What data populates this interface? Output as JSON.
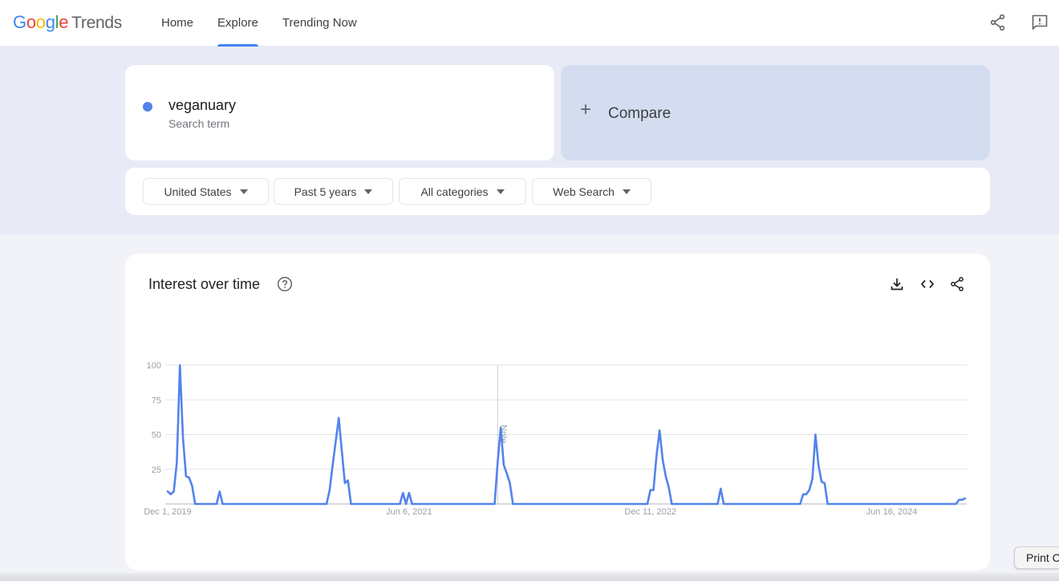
{
  "app": {
    "logo": {
      "google": [
        "G",
        "o",
        "o",
        "g",
        "l",
        "e"
      ],
      "product": "Trends"
    },
    "nav": [
      {
        "label": "Home",
        "active": false
      },
      {
        "label": "Explore",
        "active": true
      },
      {
        "label": "Trending Now",
        "active": false
      }
    ],
    "top_icons": [
      "share-icon",
      "feedback-icon"
    ]
  },
  "search": {
    "term": "veganuary",
    "term_type": "Search term",
    "term_color": "#5383ec",
    "compare_label": "Compare",
    "compare_icon": "+"
  },
  "filters": [
    {
      "label": "United States"
    },
    {
      "label": "Past 5 years"
    },
    {
      "label": "All categories"
    },
    {
      "label": "Web Search"
    }
  ],
  "card": {
    "title": "Interest over time",
    "icons": [
      "help-icon",
      "download-icon",
      "embed-icon",
      "share-icon"
    ]
  },
  "tooltip": {
    "label": "Print C"
  },
  "chart_data": {
    "type": "line",
    "title": "Interest over time",
    "xlabel": "",
    "ylabel": "",
    "ylim": [
      0,
      100
    ],
    "yticks": [
      25,
      50,
      75,
      100
    ],
    "grid": true,
    "legend": "none",
    "x_unit": "week",
    "x_start": "Dec 1, 2019",
    "num_points": 262,
    "xtick_labels": [
      {
        "label": "Dec 1, 2019",
        "week": 0
      },
      {
        "label": "Jun 6, 2021",
        "week": 79
      },
      {
        "label": "Dec 11, 2022",
        "week": 158
      },
      {
        "label": "Jun 16, 2024",
        "week": 237
      }
    ],
    "annotations": [
      {
        "label": "Note",
        "week": 108
      }
    ],
    "series": [
      {
        "name": "veganuary",
        "color": "#5383ec",
        "points": [
          [
            0,
            9
          ],
          [
            1,
            7
          ],
          [
            2,
            9
          ],
          [
            3,
            30
          ],
          [
            4,
            100
          ],
          [
            5,
            48
          ],
          [
            6,
            20
          ],
          [
            7,
            19
          ],
          [
            8,
            13
          ],
          [
            9,
            0
          ],
          [
            16,
            0
          ],
          [
            17,
            9
          ],
          [
            18,
            0
          ],
          [
            52,
            0
          ],
          [
            53,
            10
          ],
          [
            54,
            28
          ],
          [
            55,
            45
          ],
          [
            56,
            62
          ],
          [
            57,
            38
          ],
          [
            58,
            15
          ],
          [
            59,
            17
          ],
          [
            60,
            0
          ],
          [
            76,
            0
          ],
          [
            77,
            8
          ],
          [
            78,
            0
          ],
          [
            79,
            8
          ],
          [
            80,
            0
          ],
          [
            107,
            0
          ],
          [
            108,
            30
          ],
          [
            109,
            55
          ],
          [
            110,
            28
          ],
          [
            111,
            22
          ],
          [
            112,
            15
          ],
          [
            113,
            0
          ],
          [
            157,
            0
          ],
          [
            158,
            10
          ],
          [
            159,
            10
          ],
          [
            160,
            35
          ],
          [
            161,
            53
          ],
          [
            162,
            32
          ],
          [
            163,
            20
          ],
          [
            164,
            12
          ],
          [
            165,
            0
          ],
          [
            180,
            0
          ],
          [
            181,
            11
          ],
          [
            182,
            0
          ],
          [
            207,
            0
          ],
          [
            208,
            7
          ],
          [
            209,
            7
          ],
          [
            210,
            10
          ],
          [
            211,
            18
          ],
          [
            212,
            50
          ],
          [
            213,
            28
          ],
          [
            214,
            16
          ],
          [
            215,
            15
          ],
          [
            216,
            0
          ],
          [
            258,
            0
          ],
          [
            259,
            3
          ],
          [
            260,
            3
          ],
          [
            261,
            4
          ]
        ]
      }
    ]
  }
}
